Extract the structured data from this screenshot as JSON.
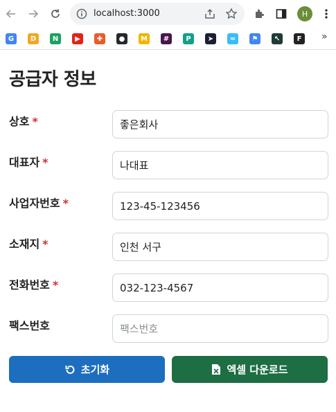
{
  "browser": {
    "url": "localhost:3000",
    "avatar_letter": "H",
    "bookmarks": [
      {
        "icon": "google-icon",
        "glyph": "G",
        "color": "#4285f4"
      },
      {
        "icon": "d-icon",
        "glyph": "D",
        "color": "#f5a623"
      },
      {
        "icon": "n-icon",
        "glyph": "N",
        "color": "#1aa260"
      },
      {
        "icon": "youtube-icon",
        "glyph": "▶",
        "color": "#e62117"
      },
      {
        "icon": "plus-circle-icon",
        "glyph": "✚",
        "color": "#ea5b2d"
      },
      {
        "icon": "github-icon",
        "glyph": "●",
        "color": "#24292e"
      },
      {
        "icon": "m-icon",
        "glyph": "M",
        "color": "#f4b400"
      },
      {
        "icon": "slack-icon",
        "glyph": "#",
        "color": "#4a154b"
      },
      {
        "icon": "p-icon",
        "glyph": "P",
        "color": "#12a089"
      },
      {
        "icon": "send-icon",
        "glyph": "➤",
        "color": "#1a1f36"
      },
      {
        "icon": "tailwind-icon",
        "glyph": "≈",
        "color": "#38bdf8"
      },
      {
        "icon": "flag-icon",
        "glyph": "⚑",
        "color": "#4285f4"
      },
      {
        "icon": "cursor-icon",
        "glyph": "↖",
        "color": "#1f3b38"
      },
      {
        "icon": "f-icon",
        "glyph": "F",
        "color": "#222222"
      }
    ],
    "more_label": "»"
  },
  "page": {
    "title": "공급자 정보"
  },
  "form": {
    "fields": [
      {
        "label": "상호",
        "required": true,
        "value": "좋은회사",
        "placeholder": "상호"
      },
      {
        "label": "대표자",
        "required": true,
        "value": "나대표",
        "placeholder": "대표자"
      },
      {
        "label": "사업자번호",
        "required": true,
        "value": "123-45-123456",
        "placeholder": "사업자번호"
      },
      {
        "label": "소재지",
        "required": true,
        "value": "인천 서구",
        "placeholder": "소재지"
      },
      {
        "label": "전화번호",
        "required": true,
        "value": "032-123-4567",
        "placeholder": "전화번호"
      },
      {
        "label": "팩스번호",
        "required": false,
        "value": "",
        "placeholder": "팩스번호"
      }
    ],
    "required_mark": "*"
  },
  "actions": {
    "reset_label": "초기화",
    "excel_label": "엑셀 다운로드",
    "reset_color": "#1d6ebf",
    "excel_color": "#1e6e43"
  }
}
